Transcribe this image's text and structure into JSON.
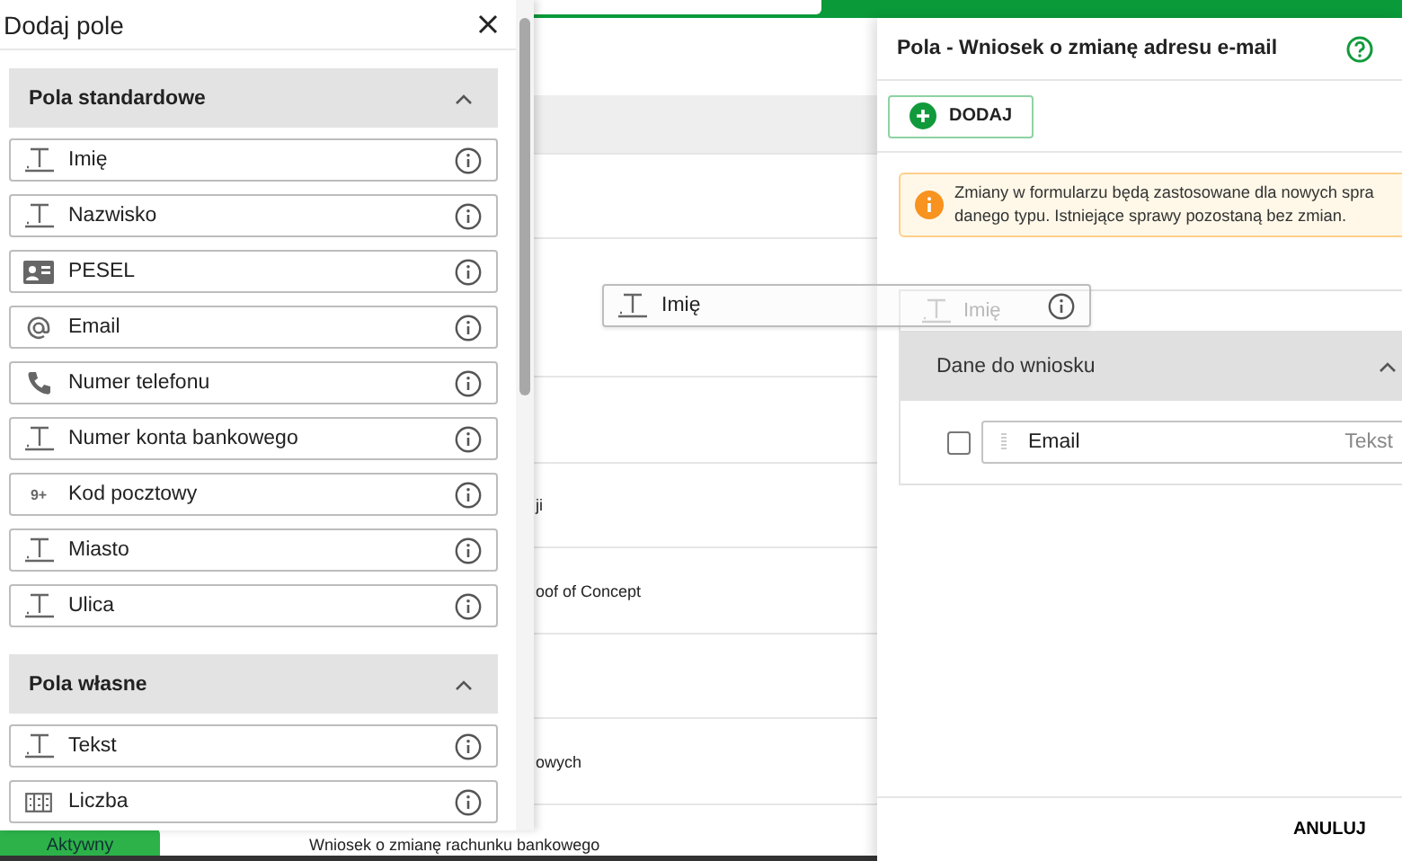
{
  "background": {
    "rows": [
      {
        "text": "ji"
      },
      {
        "text": "oof of Concept"
      },
      {
        "text": "owych"
      }
    ],
    "status_badge": "Aktywny",
    "status_text": "Wniosek o zmianę rachunku bankowego"
  },
  "add_field_drawer": {
    "title": "Dodaj pole",
    "sections": [
      {
        "title": "Pola standardowe",
        "expanded": true,
        "items": [
          {
            "label": "Imię",
            "kind": "text"
          },
          {
            "label": "Nazwisko",
            "kind": "text"
          },
          {
            "label": "PESEL",
            "kind": "id"
          },
          {
            "label": "Email",
            "kind": "email"
          },
          {
            "label": "Numer telefonu",
            "kind": "phone"
          },
          {
            "label": "Numer konta bankowego",
            "kind": "text"
          },
          {
            "label": "Kod pocztowy",
            "kind": "digits",
            "icon_text": "9+"
          },
          {
            "label": "Miasto",
            "kind": "text"
          },
          {
            "label": "Ulica",
            "kind": "text"
          }
        ]
      },
      {
        "title": "Pola własne",
        "expanded": true,
        "items": [
          {
            "label": "Tekst",
            "kind": "text"
          },
          {
            "label": "Liczba",
            "kind": "number"
          }
        ]
      }
    ]
  },
  "dragged_item": {
    "label": "Imię",
    "kind": "text"
  },
  "fields_panel": {
    "title": "Pola - Wniosek o zmianę adresu e-mail",
    "add_button": "DODAJ",
    "notice_lines": [
      "Zmiany w formularzu będą zastosowane dla nowych spra",
      "danego typu. Istniejące sprawy pozostaną bez zmian."
    ],
    "drop_placeholder": "Imię",
    "sections": [
      {
        "title": "Dane do wniosku",
        "expanded": true,
        "fields": [
          {
            "label": "Email",
            "type": "Tekst",
            "checked": false
          }
        ]
      }
    ],
    "cancel_button": "ANULUJ"
  }
}
